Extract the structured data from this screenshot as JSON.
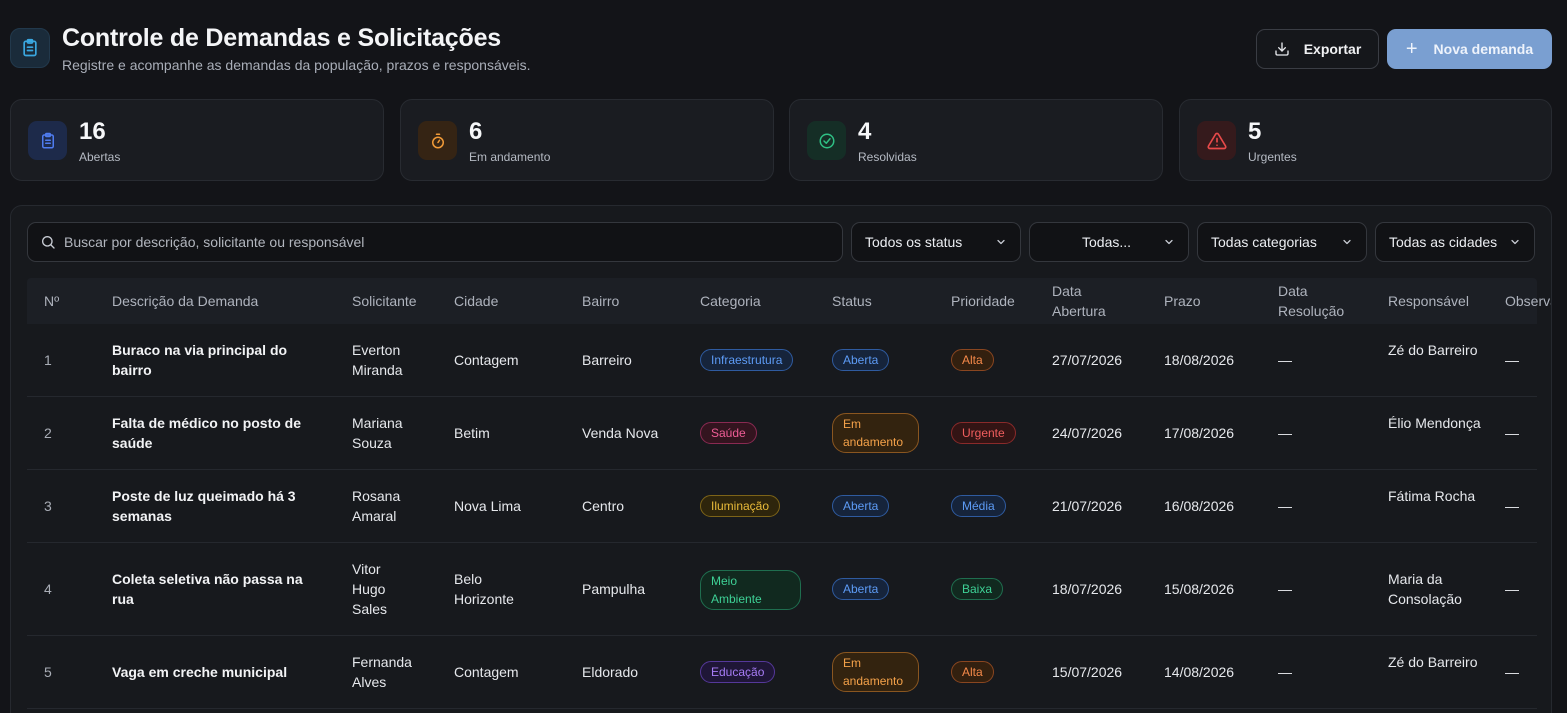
{
  "header": {
    "title": "Controle de Demandas e Solicitações",
    "subtitle": "Registre e acompanhe as demandas da população, prazos e responsáveis.",
    "export_label": "Exportar",
    "new_label": "Nova demanda"
  },
  "stats": [
    {
      "value": "16",
      "label": "Abertas",
      "icon": "clipboard-icon",
      "color": "#4f7cf0"
    },
    {
      "value": "6",
      "label": "Em andamento",
      "icon": "timer-icon",
      "color": "#f29b38"
    },
    {
      "value": "4",
      "label": "Resolvidas",
      "icon": "check-circle-icon",
      "color": "#2fbf84"
    },
    {
      "value": "5",
      "label": "Urgentes",
      "icon": "warning-icon",
      "color": "#e84a4a"
    }
  ],
  "filters": {
    "search_placeholder": "Buscar por descrição, solicitante ou responsável",
    "status": "Todos os status",
    "priority": "Todas...",
    "category": "Todas categorias",
    "city": "Todas as cidades"
  },
  "table": {
    "headers": [
      "Nº",
      "Descrição da Demanda",
      "Solicitante",
      "Cidade",
      "Bairro",
      "Categoria",
      "Status",
      "Prioridade",
      "Data Abertura",
      "Prazo",
      "Data Resolução",
      "Responsável",
      "Observações"
    ],
    "rows": [
      {
        "n": "1",
        "desc": "Buraco na via principal do bairro",
        "solicitante": "Everton Miranda",
        "cidade": "Contagem",
        "bairro": "Barreiro",
        "categoria": "Infraestrutura",
        "status": "Aberta",
        "prioridade": "Alta",
        "abertura": "27/07/2026",
        "prazo": "18/08/2026",
        "resolucao": "—",
        "responsavel": "Zé do Barreiro",
        "obs": "—"
      },
      {
        "n": "2",
        "desc": "Falta de médico no posto de saúde",
        "solicitante": "Mariana Souza",
        "cidade": "Betim",
        "bairro": "Venda Nova",
        "categoria": "Saúde",
        "status": "Em andamento",
        "prioridade": "Urgente",
        "abertura": "24/07/2026",
        "prazo": "17/08/2026",
        "resolucao": "—",
        "responsavel": "Élio Mendonça",
        "obs": "—"
      },
      {
        "n": "3",
        "desc": "Poste de luz queimado há 3 semanas",
        "solicitante": "Rosana Amaral",
        "cidade": "Nova Lima",
        "bairro": "Centro",
        "categoria": "Iluminação",
        "status": "Aberta",
        "prioridade": "Média",
        "abertura": "21/07/2026",
        "prazo": "16/08/2026",
        "resolucao": "—",
        "responsavel": "Fátima Rocha",
        "obs": "—"
      },
      {
        "n": "4",
        "desc": "Coleta seletiva não passa na rua",
        "solicitante": "Vitor Hugo Sales",
        "cidade": "Belo Horizonte",
        "bairro": "Pampulha",
        "categoria": "Meio Ambiente",
        "status": "Aberta",
        "prioridade": "Baixa",
        "abertura": "18/07/2026",
        "prazo": "15/08/2026",
        "resolucao": "—",
        "responsavel": "Maria da Consolação",
        "obs": "—"
      },
      {
        "n": "5",
        "desc": "Vaga em creche municipal",
        "solicitante": "Fernanda Alves",
        "cidade": "Contagem",
        "bairro": "Eldorado",
        "categoria": "Educação",
        "status": "Em andamento",
        "prioridade": "Alta",
        "abertura": "15/07/2026",
        "prazo": "14/08/2026",
        "resolucao": "—",
        "responsavel": "Zé do Barreiro",
        "obs": "—"
      }
    ]
  },
  "colors": {
    "Infraestrutura": "#4d8ff0",
    "Saúde": "#e64d8a",
    "Iluminação": "#e7b631",
    "Meio Ambiente": "#2fbf84",
    "Educação": "#9a6af0",
    "Aberta": "#4d8ff0",
    "Em andamento": "#f29b38",
    "Alta": "#f07b3a",
    "Urgente": "#e84a4a",
    "Média": "#4d8ff0",
    "Baixa": "#2fbf84"
  }
}
